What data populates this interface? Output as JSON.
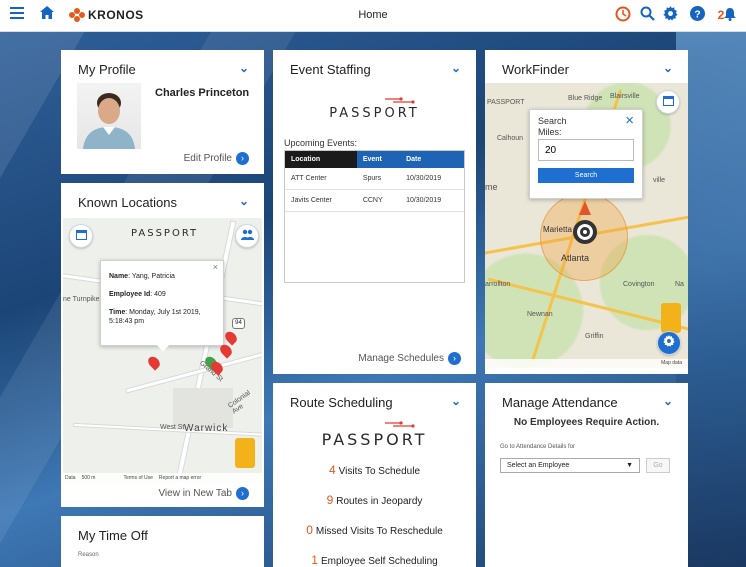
{
  "header": {
    "title": "Home",
    "brand": "KRONOS",
    "notification_count": "2",
    "colors": {
      "accent": "#1565c0",
      "brand": "#e35b1f",
      "alert": "#e8541e"
    }
  },
  "my_profile": {
    "title": "My Profile",
    "name": "Charles Princeton",
    "edit_link": "Edit Profile"
  },
  "known_locations": {
    "title": "Known Locations",
    "passport": "PASSPORT",
    "popup": {
      "name_label": "Name",
      "name_value": "Yang, Patricia",
      "employee_label": "Employee Id",
      "employee_value": "409",
      "time_label": "Time",
      "time_value": "Monday, July 1st 2019, 5:18:43 pm",
      "close": "×"
    },
    "map_labels": {
      "turnpike": "ne Turnpike",
      "grand": "Grand St",
      "colonial": "Colonial Ave",
      "west_st": "West St",
      "warwick": "Warwick",
      "route": "94",
      "data": "Data",
      "scale": "500 m",
      "terms": "Terms of Use",
      "report": "Report a map error"
    },
    "view_link": "View in New Tab"
  },
  "my_time_off": {
    "title": "My Time Off",
    "reason_label": "Reason"
  },
  "event_staffing": {
    "title": "Event Staffing",
    "passport": "PASSPORT",
    "upcoming_label": "Upcoming Events:",
    "columns": [
      "Location",
      "Event",
      "Date"
    ],
    "rows": [
      [
        "ATT Center",
        "Spurs",
        "10/30/2019"
      ],
      [
        "Javits Center",
        "CCNY",
        "10/30/2019"
      ]
    ],
    "manage_link": "Manage Schedules"
  },
  "route_scheduling": {
    "title": "Route Scheduling",
    "passport": "PASSPORT",
    "stats": [
      {
        "count": "4",
        "label": "Visits To Schedule"
      },
      {
        "count": "9",
        "label": "Routes in Jeopardy"
      },
      {
        "count": "0",
        "label": "Missed Visits To Reschedule"
      },
      {
        "count": "1",
        "label": "Employee Self Scheduling"
      }
    ]
  },
  "workfinder": {
    "title": "WorkFinder",
    "search_title": "Search",
    "miles_label": "Miles:",
    "miles_value": "20",
    "search_button": "Search",
    "close": "×",
    "map_labels": {
      "passport": "PASSPORT",
      "blue_ridge": "Blue Ridge",
      "blairsville": "Blairsville",
      "calhoun": "Calhoun",
      "rome": "me",
      "marietta": "Marietta",
      "atlanta": "Atlanta",
      "carrollton": "arrollton",
      "newnan": "Newnan",
      "covington": "Covington",
      "griffin": "Griffin",
      "ville": "ville",
      "na": "Na",
      "map_data": "Map data"
    }
  },
  "manage_attendance": {
    "title": "Manage Attendance",
    "message": "No Employees Require Action.",
    "goto_label": "Go to Attendance Details for",
    "select_placeholder": "Select an Employee",
    "go_button": "Go"
  }
}
